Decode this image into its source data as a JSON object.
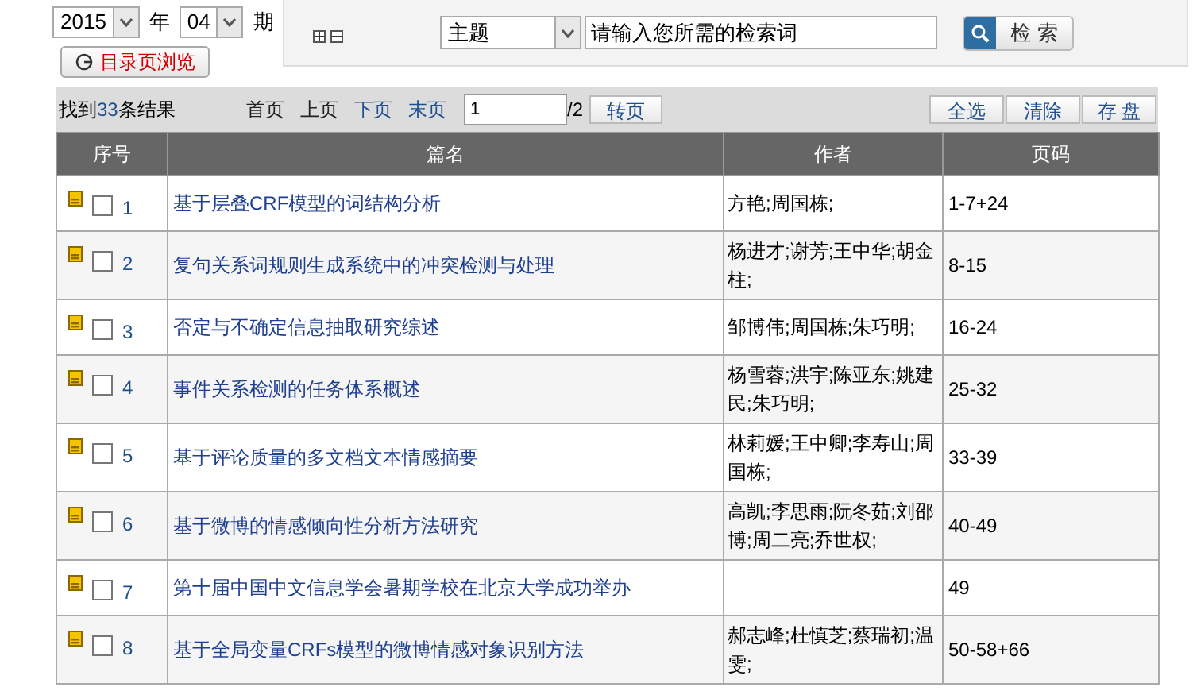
{
  "period": {
    "year": "2015",
    "year_unit": "年",
    "issue": "04",
    "issue_unit": "期",
    "browse_button": "目录页浏览"
  },
  "search": {
    "field": "主题",
    "placeholder": "请输入您所需的检索词",
    "button": "检 索"
  },
  "toolbar": {
    "found_prefix": "找到",
    "count": "33",
    "found_suffix": "条结果",
    "pager": [
      {
        "label": "首页",
        "enabled": false
      },
      {
        "label": "上页",
        "enabled": false
      },
      {
        "label": "下页",
        "enabled": true
      },
      {
        "label": "末页",
        "enabled": true
      }
    ],
    "page_value": "1",
    "page_total": "/2",
    "go_button": "转页",
    "actions": [
      "全选",
      "清除",
      "存 盘"
    ]
  },
  "table": {
    "columns": [
      "序号",
      "篇名",
      "作者",
      "页码"
    ],
    "rows": [
      {
        "number": "1",
        "checked": false,
        "title": "基于层叠CRF模型的词结构分析",
        "authors": "方艳;周国栋;",
        "pages": "1-7+24"
      },
      {
        "number": "2",
        "checked": false,
        "title": "复句关系词规则生成系统中的冲突检测与处理",
        "authors": "杨进才;谢芳;王中华;胡金柱;",
        "pages": "8-15"
      },
      {
        "number": "3",
        "checked": false,
        "title": "否定与不确定信息抽取研究综述",
        "authors": "邹博伟;周国栋;朱巧明;",
        "pages": "16-24"
      },
      {
        "number": "4",
        "checked": false,
        "title": "事件关系检测的任务体系概述",
        "authors": "杨雪蓉;洪宇;陈亚东;姚建民;朱巧明;",
        "pages": "25-32"
      },
      {
        "number": "5",
        "checked": false,
        "title": "基于评论质量的多文档文本情感摘要",
        "authors": "林莉媛;王中卿;李寿山;周国栋;",
        "pages": "33-39"
      },
      {
        "number": "6",
        "checked": false,
        "title": "基于微博的情感倾向性分析方法研究",
        "authors": "高凯;李思雨;阮冬茹;刘邵博;周二亮;乔世权;",
        "pages": "40-49"
      },
      {
        "number": "7",
        "checked": false,
        "title": "第十届中国中文信息学会暑期学校在北京大学成功举办",
        "authors": "",
        "pages": "49"
      },
      {
        "number": "8",
        "checked": false,
        "title": "基于全局变量CRFs模型的微博情感对象识别方法",
        "authors": "郝志峰;杜慎芝;蔡瑞初;温雯;",
        "pages": "50-58+66"
      }
    ]
  }
}
